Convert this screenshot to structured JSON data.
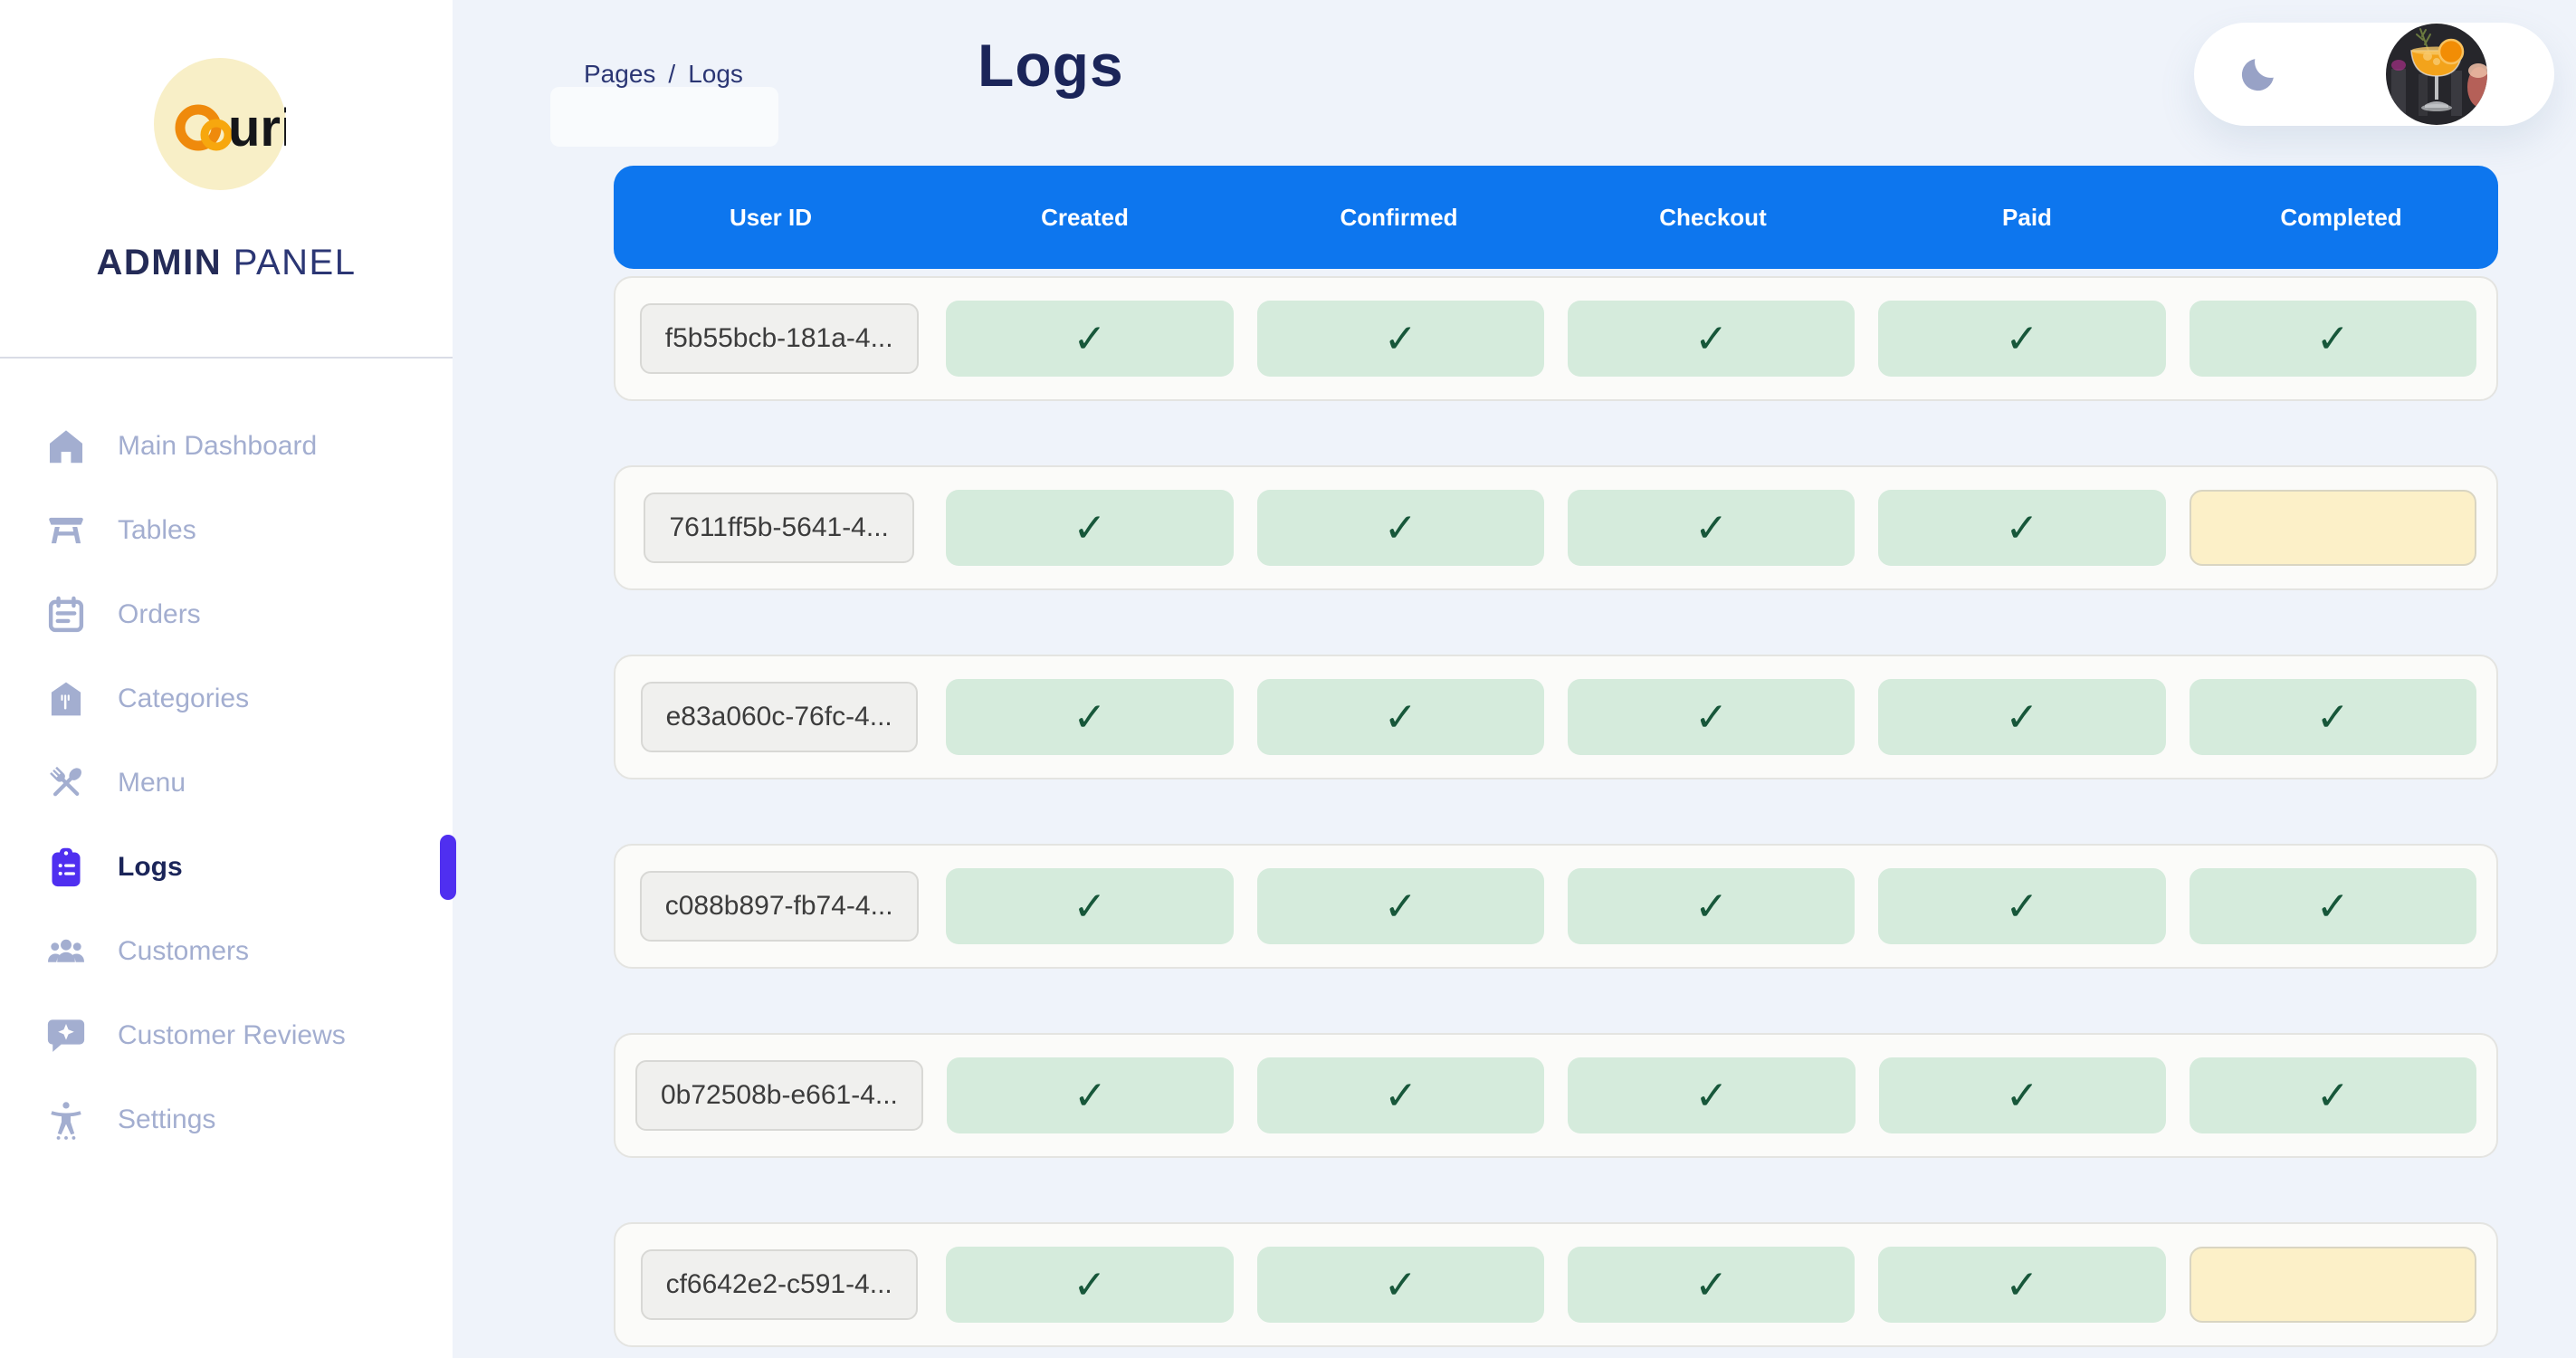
{
  "brand": {
    "logo_text": "uri",
    "admin": "ADMIN",
    "panel": "PANEL"
  },
  "sidebar": {
    "items": [
      {
        "id": "main-dashboard",
        "label": "Main Dashboard",
        "icon": "home",
        "active": false
      },
      {
        "id": "tables",
        "label": "Tables",
        "icon": "table",
        "active": false
      },
      {
        "id": "orders",
        "label": "Orders",
        "icon": "orders",
        "active": false
      },
      {
        "id": "categories",
        "label": "Categories",
        "icon": "categories",
        "active": false
      },
      {
        "id": "menu",
        "label": "Menu",
        "icon": "menu",
        "active": false
      },
      {
        "id": "logs",
        "label": "Logs",
        "icon": "logs",
        "active": true
      },
      {
        "id": "customers",
        "label": "Customers",
        "icon": "customers",
        "active": false
      },
      {
        "id": "customer-reviews",
        "label": "Customer Reviews",
        "icon": "reviews",
        "active": false
      },
      {
        "id": "settings",
        "label": "Settings",
        "icon": "settings",
        "active": false
      }
    ]
  },
  "topbar": {
    "breadcrumb_root": "Pages",
    "breadcrumb_separator": "/",
    "breadcrumb_current": "Logs",
    "page_title": "Logs",
    "theme_toggle_icon": "moon-icon",
    "avatar_icon": "cocktail-photo-avatar"
  },
  "table": {
    "columns": [
      "User ID",
      "Created",
      "Confirmed",
      "Checkout",
      "Paid",
      "Completed"
    ],
    "status_keys": [
      "created",
      "confirmed",
      "checkout",
      "paid",
      "completed"
    ],
    "check_glyph": "✓",
    "rows": [
      {
        "user_id": "f5b55bcb-181a-4...",
        "created": "done",
        "confirmed": "done",
        "checkout": "done",
        "paid": "done",
        "completed": "done"
      },
      {
        "user_id": "7611ff5b-5641-4...",
        "created": "done",
        "confirmed": "done",
        "checkout": "done",
        "paid": "done",
        "completed": "pending"
      },
      {
        "user_id": "e83a060c-76fc-4...",
        "created": "done",
        "confirmed": "done",
        "checkout": "done",
        "paid": "done",
        "completed": "done"
      },
      {
        "user_id": "c088b897-fb74-4...",
        "created": "done",
        "confirmed": "done",
        "checkout": "done",
        "paid": "done",
        "completed": "done"
      },
      {
        "user_id": "0b72508b-e661-4...",
        "created": "done",
        "confirmed": "done",
        "checkout": "done",
        "paid": "done",
        "completed": "done"
      },
      {
        "user_id": "cf6642e2-c591-4...",
        "created": "done",
        "confirmed": "done",
        "checkout": "done",
        "paid": "done",
        "completed": "pending"
      }
    ]
  },
  "colors": {
    "page_background": "#eff3fa",
    "sidebar_background": "#ffffff",
    "navy_text": "#1b2559",
    "sidebar_muted_text": "#a3aed0",
    "accent_indigo": "#4f2ff0",
    "table_header_blue": "#0d76ee",
    "status_done_background": "#d5ebdc",
    "status_done_check": "#17573a",
    "status_pending_background": "#fcf0c8",
    "row_card_background": "#fbfbf9",
    "logo_circle": "#f8efc7",
    "logo_orange": "#ef8a0c"
  }
}
